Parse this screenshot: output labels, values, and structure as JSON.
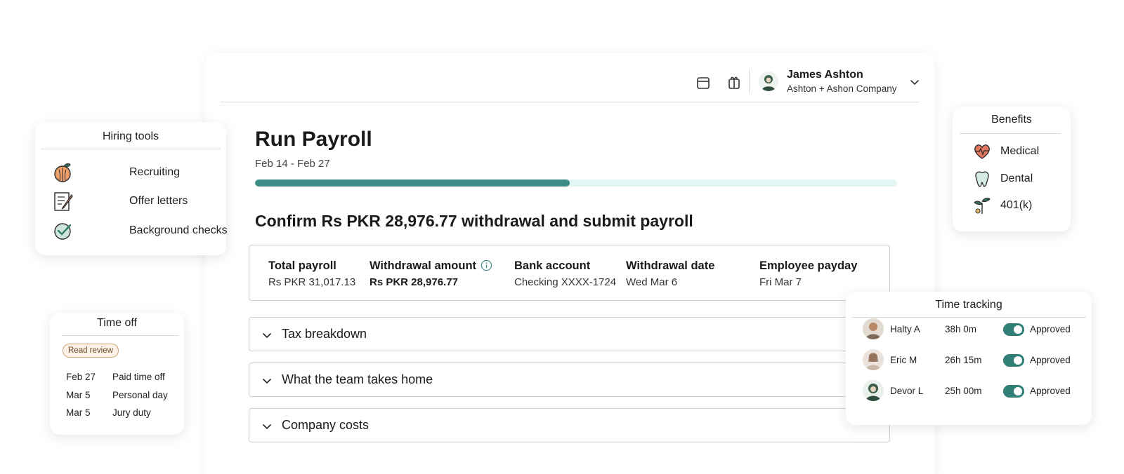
{
  "colors": {
    "accent": "#3a8c84",
    "progress_track": "#e2f6f3",
    "toggle_on": "#2f7f77"
  },
  "header": {
    "user_name": "James Ashton",
    "company": "Ashton + Ashon Company",
    "icons": [
      "calendar-icon",
      "gift-icon",
      "avatar",
      "chevron-down-icon"
    ]
  },
  "payroll": {
    "title": "Run Payroll",
    "date_range": "Feb 14 - Feb 27",
    "progress_fraction": 0.49,
    "confirm_title": "Confirm Rs PKR 28,976.77 withdrawal and submit payroll",
    "summary": [
      {
        "label": "Total payroll",
        "value": "Rs PKR 31,017.13"
      },
      {
        "label": "Withdrawal amount",
        "value": "Rs PKR 28,976.77"
      },
      {
        "label": "Bank account",
        "value": "Checking XXXX-1724"
      },
      {
        "label": "Withdrawal date",
        "value": "Wed Mar 6"
      },
      {
        "label": "Employee payday",
        "value": "Fri Mar 7"
      }
    ],
    "sections": [
      "Tax breakdown",
      "What the team takes home",
      "Company costs"
    ]
  },
  "hiring_tools": {
    "title": "Hiring tools",
    "items": [
      "Recruiting",
      "Offer letters",
      "Background checks"
    ]
  },
  "time_off": {
    "title": "Time off",
    "badge": "Read review",
    "entries": [
      {
        "date": "Feb 27",
        "type": "Paid time off"
      },
      {
        "date": "Mar 5",
        "type": "Personal day"
      },
      {
        "date": "Mar 5",
        "type": "Jury duty"
      }
    ]
  },
  "benefits": {
    "title": "Benefits",
    "items": [
      "Medical",
      "Dental",
      "401(k)"
    ]
  },
  "time_tracking": {
    "title": "Time tracking",
    "rows": [
      {
        "name": "Halty A",
        "hours": "38h 0m",
        "status": "Approved"
      },
      {
        "name": "Eric M",
        "hours": "26h 15m",
        "status": "Approved"
      },
      {
        "name": "Devor L",
        "hours": "25h 00m",
        "status": "Approved"
      }
    ]
  }
}
